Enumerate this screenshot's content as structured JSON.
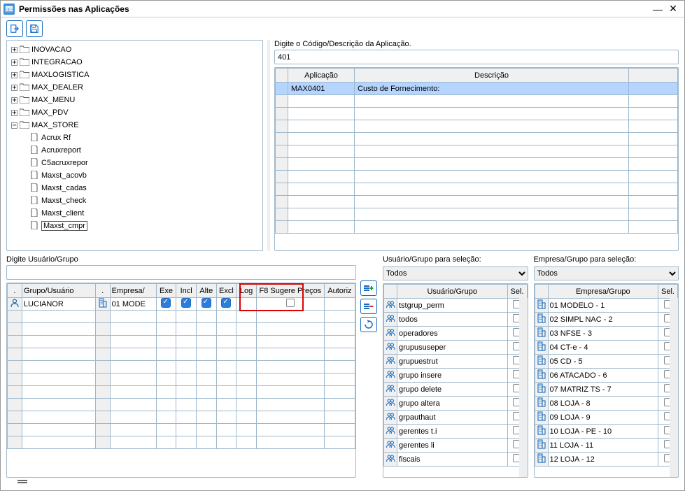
{
  "title": "Permissões nas Aplicações",
  "tree": {
    "folders_collapsed": [
      "INOVACAO",
      "INTEGRACAO",
      "MAXLOGISTICA",
      "MAX_DEALER",
      "MAX_MENU",
      "MAX_PDV"
    ],
    "folder_expanded": "MAX_STORE",
    "files": [
      "Acrux Rf",
      "Acruxreport",
      "C5acruxrepor",
      "Maxst_acovb",
      "Maxst_cadas",
      "Maxst_check",
      "Maxst_client",
      "Maxst_cmpr"
    ],
    "selected_file": "Maxst_cmpr"
  },
  "search_label": "Digite o Código/Descrição da Aplicação.",
  "search_value": "401",
  "apps_headers": {
    "app": "Aplicação",
    "desc": "Descrição"
  },
  "apps_rows": [
    {
      "app": "MAX0401",
      "desc": "Custo de Fornecimento:"
    }
  ],
  "user_search_label": "Digite Usuário/Grupo",
  "perm_headers": {
    "min1": ".",
    "user": "Grupo/Usuário",
    "min2": ".",
    "emp": "Empresa/",
    "exe": "Exe",
    "inc": "Incl",
    "alt": "Alte",
    "exc": "Excl",
    "log": "Log",
    "f8": "F8 Sugere Preços",
    "aut": "Autoriz"
  },
  "perm_rows": [
    {
      "user": "LUCIANOR",
      "emp": "01 MODE",
      "exe": true,
      "inc": true,
      "alt": true,
      "exc": true,
      "log": false,
      "f8": false
    }
  ],
  "sel_user_label": "Usuário/Grupo para seleção:",
  "sel_emp_label": "Empresa/Grupo para seleção:",
  "dropdown_all": "Todos",
  "sel_user_header": "Usuário/Grupo",
  "sel_emp_header": "Empresa/Grupo",
  "sel_header_sel": "Sel.",
  "sel_users": [
    "tstgrup_perm",
    "todos",
    "operadores",
    "grupususeper",
    "grupuestrut",
    "grupo insere",
    "grupo delete",
    "grupo altera",
    "grpauthaut",
    "gerentes t.i",
    "gerentes li",
    "fiscais"
  ],
  "sel_emps": [
    "01 MODELO - 1",
    "02 SIMPL NAC - 2",
    "03 NFSE - 3",
    "04 CT-e - 4",
    "05 CD - 5",
    "06 ATACADO - 6",
    "07 MATRIZ TS - 7",
    "08 LOJA - 8",
    "09 LOJA - 9",
    "10 LOJA - PE - 10",
    "11 LOJA - 11",
    "12 LOJA - 12"
  ]
}
